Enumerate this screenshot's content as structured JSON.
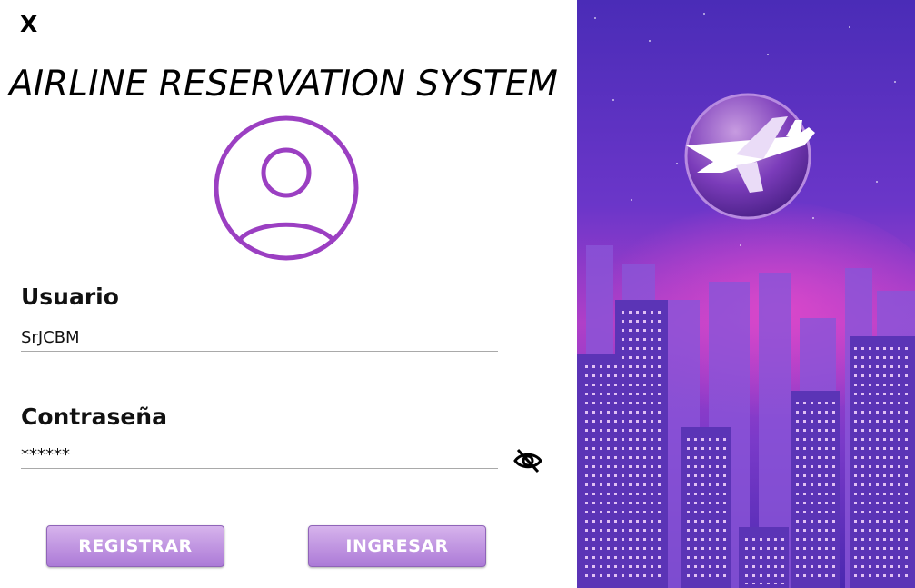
{
  "window": {
    "close_label": "X"
  },
  "header": {
    "title": "AIRLINE RESERVATION SYSTEM"
  },
  "form": {
    "user_label": "Usuario",
    "user_value": "SrJCBM",
    "password_label": "Contraseña",
    "password_value": "******"
  },
  "buttons": {
    "register_label": "REGISTRAR",
    "login_label": "INGRESAR"
  },
  "icons": {
    "avatar": "user-circle-icon",
    "eye": "eye-slash-icon",
    "logo": "airplane-icon"
  },
  "colors": {
    "accent": "#9b3fc2",
    "button_top": "#d6b3ec",
    "button_bottom": "#ac7ad7",
    "panel_top": "#5a2fc0",
    "panel_glow": "#d43fc9"
  }
}
